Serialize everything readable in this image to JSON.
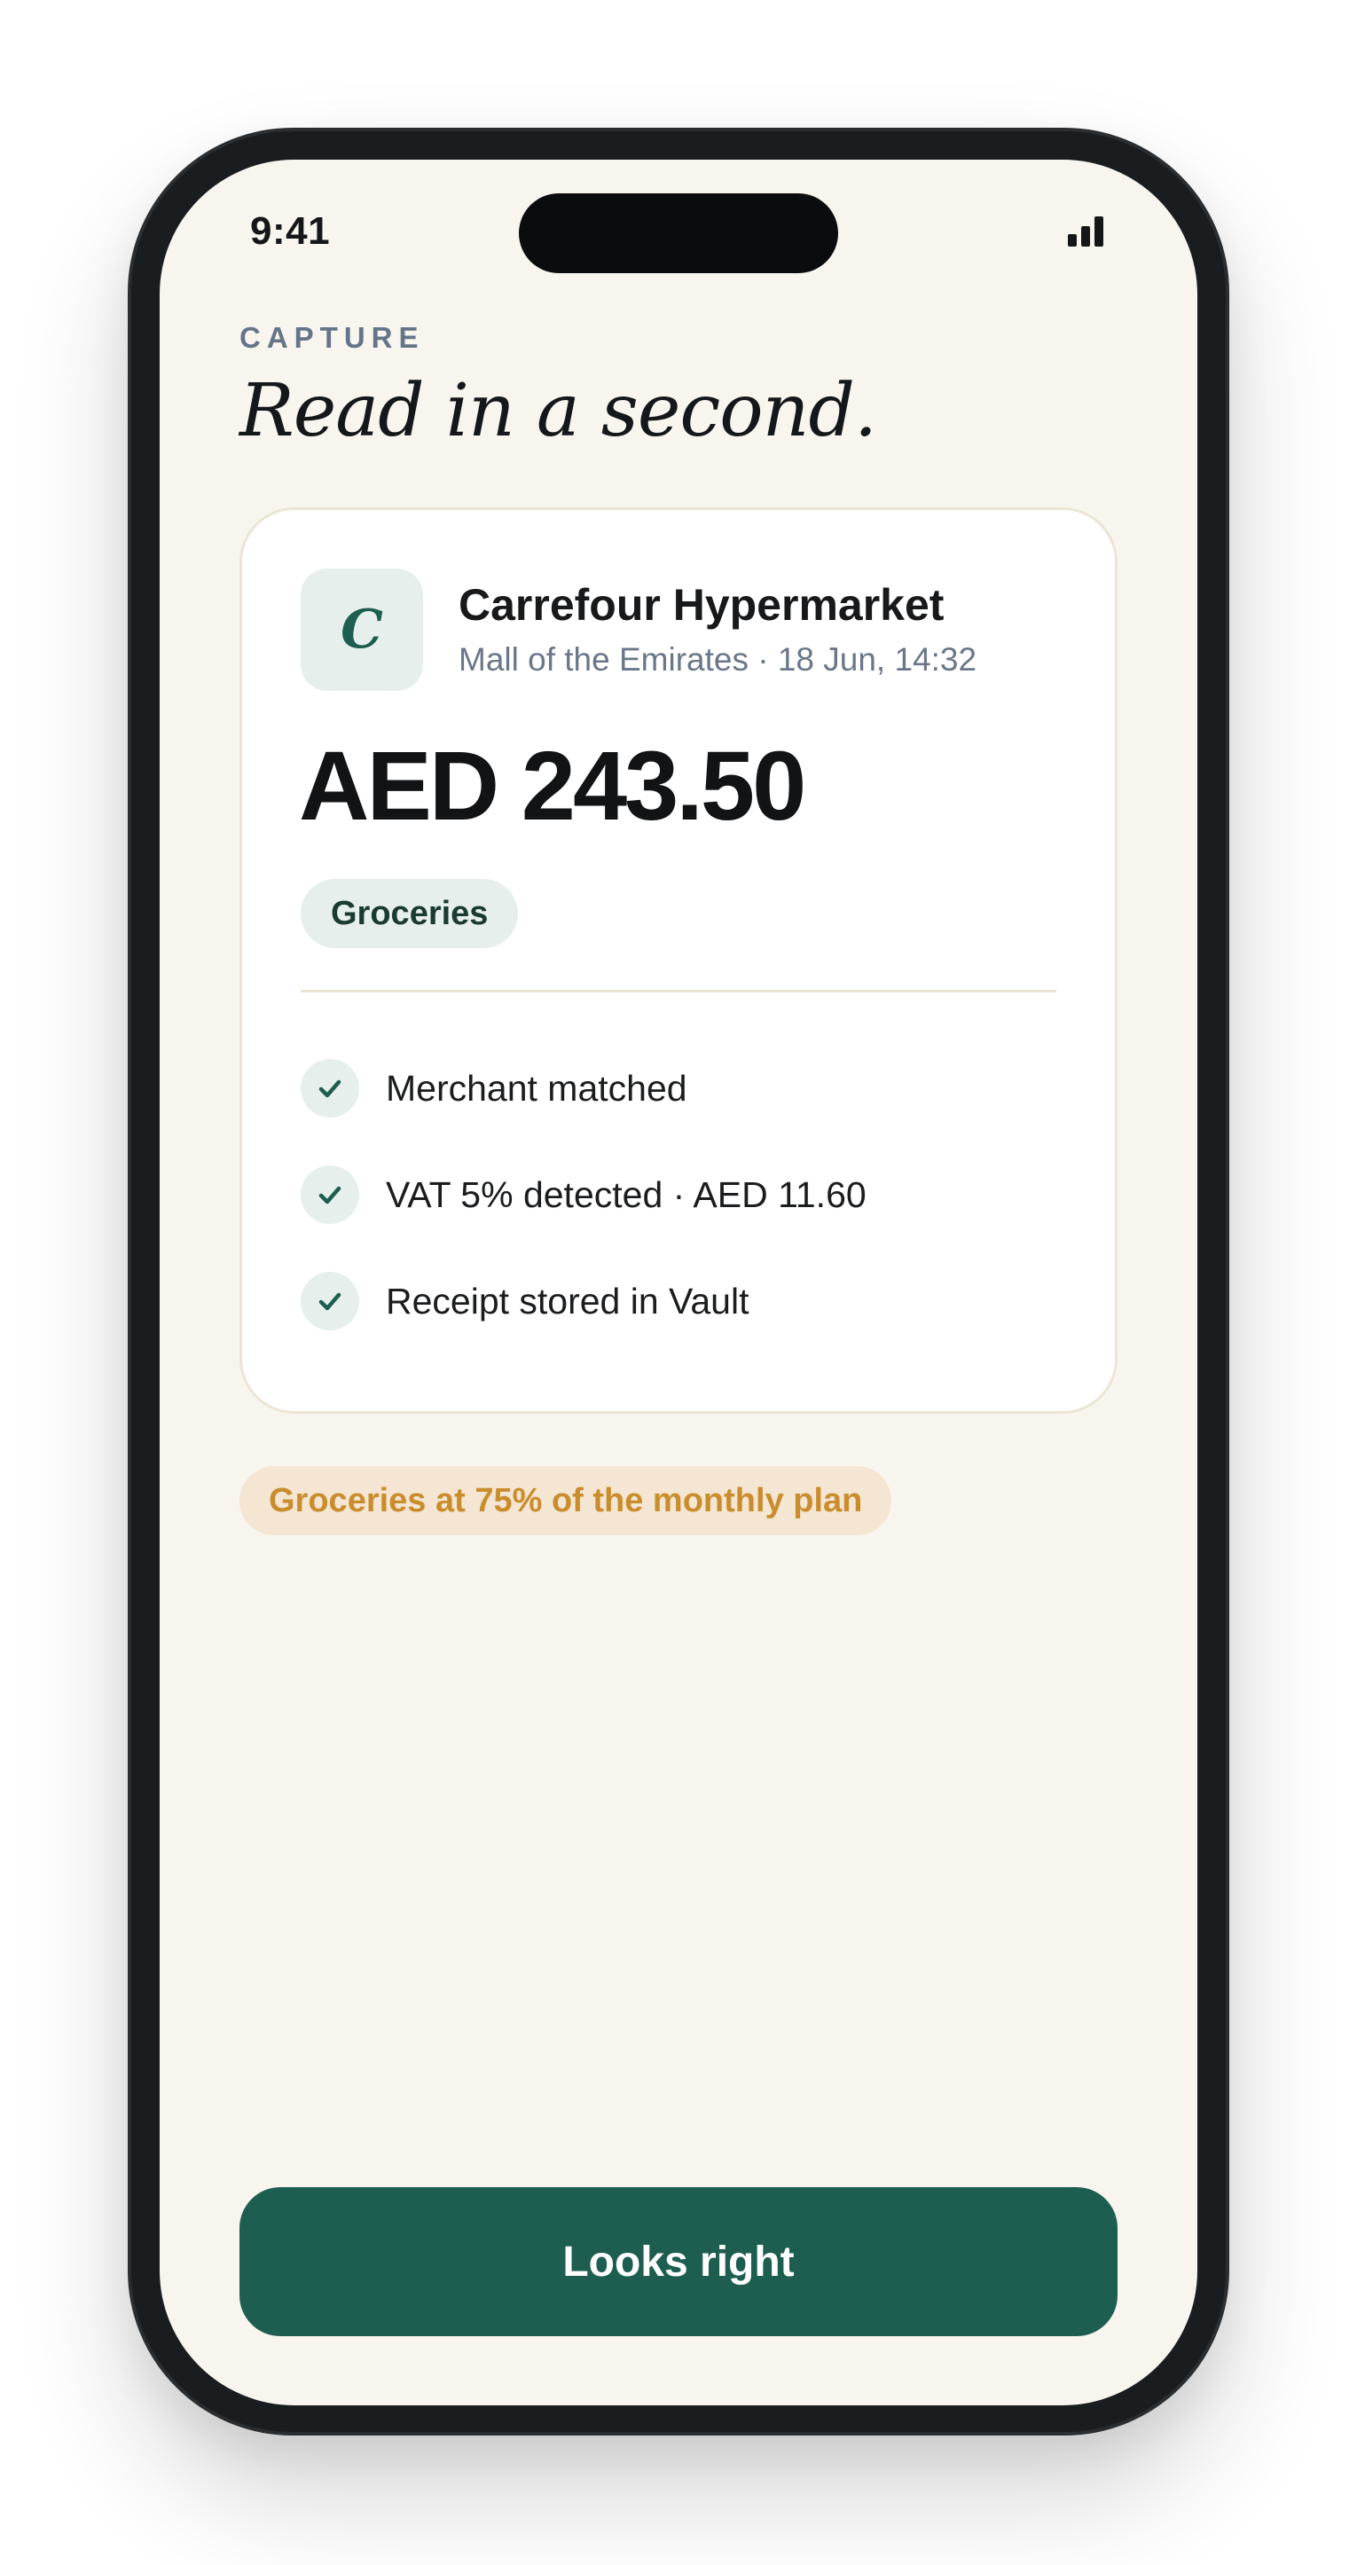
{
  "status_bar": {
    "time": "9:41",
    "signal_icon": "signal-bars-icon"
  },
  "header": {
    "eyebrow": "CAPTURE",
    "title": "Read in a second."
  },
  "receipt": {
    "logo_letter": "C",
    "merchant": "Carrefour Hypermarket",
    "location_time": "Mall of the Emirates · 18 Jun, 14:32",
    "amount": "AED 243.50",
    "category": "Groceries",
    "checks": [
      {
        "icon": "check-icon",
        "label": "Merchant matched"
      },
      {
        "icon": "check-icon",
        "label": "VAT 5% detected · AED 11.60"
      },
      {
        "icon": "check-icon",
        "label": "Receipt stored in Vault"
      }
    ]
  },
  "budget_notice": "Groceries at 75% of the monthly plan",
  "cta": {
    "label": "Looks right"
  },
  "colors": {
    "brand": "#1d5e50",
    "background": "#f8f5ef",
    "warning_text": "#c98d2d",
    "warning_bg": "#f4e6d2"
  }
}
